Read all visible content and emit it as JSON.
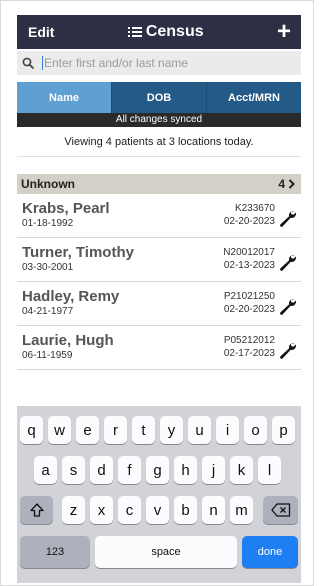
{
  "header": {
    "edit_label": "Edit",
    "title": "Census",
    "add_label": "+"
  },
  "search": {
    "placeholder": "Enter first and/or last name",
    "value": ""
  },
  "tabs": [
    {
      "label": "Name",
      "active": true
    },
    {
      "label": "DOB",
      "active": false
    },
    {
      "label": "Acct/MRN",
      "active": false
    }
  ],
  "sync_status": "All changes synced",
  "summary": "Viewing 4 patients at 3 locations today.",
  "group": {
    "label": "Unknown",
    "count": "4"
  },
  "patients": [
    {
      "name": "Krabs, Pearl",
      "dob": "01-18-1992",
      "acct": "K233670",
      "date": "02-20-2023"
    },
    {
      "name": "Turner, Timothy",
      "dob": "03-30-2001",
      "acct": "N20012017",
      "date": "02-13-2023"
    },
    {
      "name": "Hadley, Remy",
      "dob": "04-21-1977",
      "acct": "P21021250",
      "date": "02-20-2023"
    },
    {
      "name": "Laurie, Hugh",
      "dob": "06-11-1959",
      "acct": "P05212012",
      "date": "02-17-2023"
    }
  ],
  "keyboard": {
    "row1": [
      "q",
      "w",
      "e",
      "r",
      "t",
      "y",
      "u",
      "i",
      "o",
      "p"
    ],
    "row2": [
      "a",
      "s",
      "d",
      "f",
      "g",
      "h",
      "j",
      "k",
      "l"
    ],
    "row3": [
      "z",
      "x",
      "c",
      "v",
      "b",
      "n",
      "m"
    ],
    "numbers_label": "123",
    "space_label": "space",
    "done_label": "done"
  },
  "colors": {
    "header_bg": "#2e2f45",
    "tab_bg": "#235a87",
    "tab_active_bg": "#5fa0d2",
    "group_bg": "#d3d0c8",
    "done_key": "#1e7ff5"
  },
  "icons": {
    "list": "list-icon",
    "search": "search-icon",
    "chevron": "chevron-right-icon",
    "wrench": "wrench-icon",
    "shift": "shift-icon",
    "backspace": "backspace-icon"
  }
}
